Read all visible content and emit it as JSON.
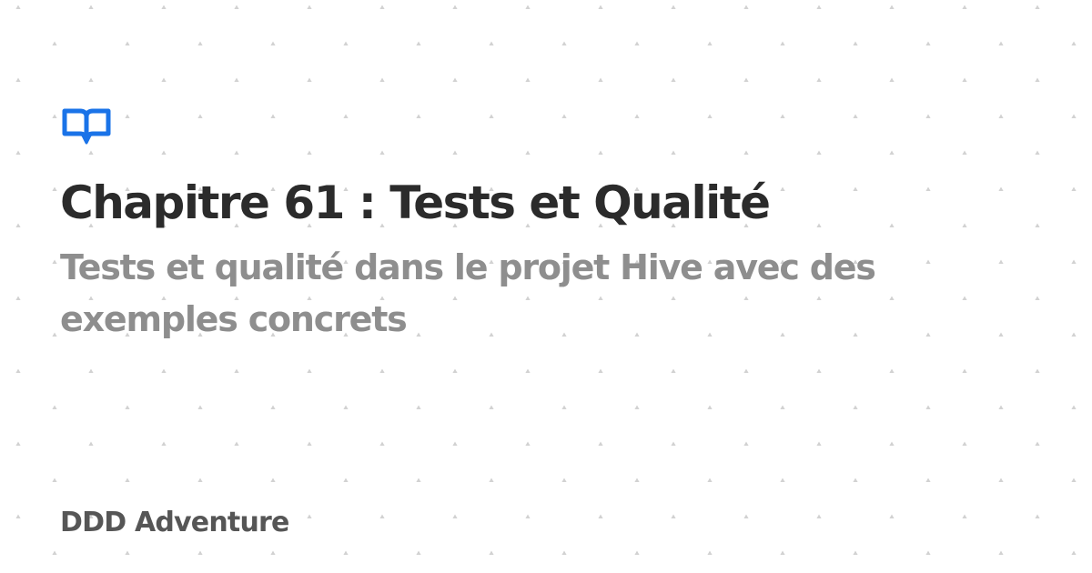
{
  "card": {
    "title": "Chapitre 61 : Tests et Qualité",
    "subtitle": "Tests et qualité dans le projet Hive avec des exemples concrets",
    "brand": "DDD Adventure"
  },
  "colors": {
    "background": "#ffffff",
    "pattern": "#d2d2d2",
    "accent": "#1a73e8",
    "title": "#2b2b2b",
    "subtitle": "#8e8e8e",
    "brand": "#565656"
  },
  "icons": {
    "logo": "open-book-icon"
  }
}
